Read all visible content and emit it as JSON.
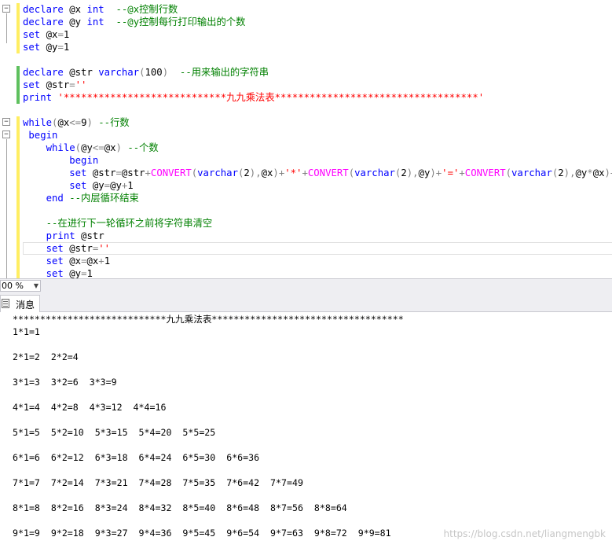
{
  "editor": {
    "lines": [
      [
        {
          "t": "declare",
          "c": "k"
        },
        {
          "t": " @x "
        },
        {
          "t": "int",
          "c": "k"
        },
        {
          "t": "  "
        },
        {
          "t": "--@x控制行数",
          "c": "c"
        }
      ],
      [
        {
          "t": "declare",
          "c": "k"
        },
        {
          "t": " @y "
        },
        {
          "t": "int",
          "c": "k"
        },
        {
          "t": "  "
        },
        {
          "t": "--@y控制每行打印输出的个数",
          "c": "c"
        }
      ],
      [
        {
          "t": "set",
          "c": "k"
        },
        {
          "t": " @x"
        },
        {
          "t": "=",
          "c": "g"
        },
        {
          "t": "1"
        }
      ],
      [
        {
          "t": "set",
          "c": "k"
        },
        {
          "t": " @y"
        },
        {
          "t": "=",
          "c": "g"
        },
        {
          "t": "1"
        }
      ],
      [],
      [
        {
          "t": "declare",
          "c": "k"
        },
        {
          "t": " @str "
        },
        {
          "t": "varchar",
          "c": "k"
        },
        {
          "t": "(",
          "c": "g"
        },
        {
          "t": "100"
        },
        {
          "t": ")",
          "c": "g"
        },
        {
          "t": "  "
        },
        {
          "t": "--用来输出的字符串",
          "c": "c"
        }
      ],
      [
        {
          "t": "set",
          "c": "k"
        },
        {
          "t": " @str"
        },
        {
          "t": "=",
          "c": "g"
        },
        {
          "t": "''",
          "c": "s"
        }
      ],
      [
        {
          "t": "print",
          "c": "k"
        },
        {
          "t": " "
        },
        {
          "t": "'****************************九九乘法表***********************************'",
          "c": "s"
        }
      ],
      [],
      [
        {
          "t": "while",
          "c": "k"
        },
        {
          "t": "(",
          "c": "g"
        },
        {
          "t": "@x"
        },
        {
          "t": "<=",
          "c": "g"
        },
        {
          "t": "9"
        },
        {
          "t": ")",
          "c": "g"
        },
        {
          "t": " "
        },
        {
          "t": "--行数",
          "c": "c"
        }
      ],
      [
        {
          "t": " "
        },
        {
          "t": "begin",
          "c": "k"
        }
      ],
      [
        {
          "t": "    "
        },
        {
          "t": "while",
          "c": "k"
        },
        {
          "t": "(",
          "c": "g"
        },
        {
          "t": "@y"
        },
        {
          "t": "<=",
          "c": "g"
        },
        {
          "t": "@x"
        },
        {
          "t": ")",
          "c": "g"
        },
        {
          "t": " "
        },
        {
          "t": "--个数",
          "c": "c"
        }
      ],
      [
        {
          "t": "        "
        },
        {
          "t": "begin",
          "c": "k"
        }
      ],
      [
        {
          "t": "        "
        },
        {
          "t": "set",
          "c": "k"
        },
        {
          "t": " @str"
        },
        {
          "t": "=",
          "c": "g"
        },
        {
          "t": "@str"
        },
        {
          "t": "+",
          "c": "g"
        },
        {
          "t": "CONVERT",
          "c": "f"
        },
        {
          "t": "(",
          "c": "g"
        },
        {
          "t": "varchar",
          "c": "k"
        },
        {
          "t": "(",
          "c": "g"
        },
        {
          "t": "2"
        },
        {
          "t": "),",
          "c": "g"
        },
        {
          "t": "@x"
        },
        {
          "t": ")+",
          "c": "g"
        },
        {
          "t": "'*'",
          "c": "s"
        },
        {
          "t": "+",
          "c": "g"
        },
        {
          "t": "CONVERT",
          "c": "f"
        },
        {
          "t": "(",
          "c": "g"
        },
        {
          "t": "varchar",
          "c": "k"
        },
        {
          "t": "(",
          "c": "g"
        },
        {
          "t": "2"
        },
        {
          "t": "),",
          "c": "g"
        },
        {
          "t": "@y"
        },
        {
          "t": ")+",
          "c": "g"
        },
        {
          "t": "'='",
          "c": "s"
        },
        {
          "t": "+",
          "c": "g"
        },
        {
          "t": "CONVERT",
          "c": "f"
        },
        {
          "t": "(",
          "c": "g"
        },
        {
          "t": "varchar",
          "c": "k"
        },
        {
          "t": "(",
          "c": "g"
        },
        {
          "t": "2"
        },
        {
          "t": "),",
          "c": "g"
        },
        {
          "t": "@y"
        },
        {
          "t": "*",
          "c": "g"
        },
        {
          "t": "@x"
        },
        {
          "t": ")+",
          "c": "g"
        },
        {
          "t": "'  '",
          "c": "s"
        }
      ],
      [
        {
          "t": "        "
        },
        {
          "t": "set",
          "c": "k"
        },
        {
          "t": " @y"
        },
        {
          "t": "=",
          "c": "g"
        },
        {
          "t": "@y"
        },
        {
          "t": "+",
          "c": "g"
        },
        {
          "t": "1"
        }
      ],
      [
        {
          "t": "    "
        },
        {
          "t": "end",
          "c": "k"
        },
        {
          "t": " "
        },
        {
          "t": "--内层循环结束",
          "c": "c"
        }
      ],
      [],
      [
        {
          "t": "    "
        },
        {
          "t": "--在进行下一轮循环之前将字符串清空",
          "c": "c"
        }
      ],
      [
        {
          "t": "    "
        },
        {
          "t": "print",
          "c": "k"
        },
        {
          "t": " @str"
        }
      ],
      [
        {
          "t": "    "
        },
        {
          "t": "set",
          "c": "k"
        },
        {
          "t": " @str"
        },
        {
          "t": "=",
          "c": "g"
        },
        {
          "t": "''",
          "c": "s"
        }
      ],
      [
        {
          "t": "    "
        },
        {
          "t": "set",
          "c": "k"
        },
        {
          "t": " @x"
        },
        {
          "t": "=",
          "c": "g"
        },
        {
          "t": "@x"
        },
        {
          "t": "+",
          "c": "g"
        },
        {
          "t": "1"
        }
      ],
      [
        {
          "t": "    "
        },
        {
          "t": "set",
          "c": "k"
        },
        {
          "t": " @y"
        },
        {
          "t": "=",
          "c": "g"
        },
        {
          "t": "1"
        }
      ]
    ]
  },
  "zoom": {
    "value": "00 %"
  },
  "results": {
    "tab_label": "消息",
    "messages": [
      "****************************九九乘法表***********************************",
      "1*1=1",
      "2*1=2  2*2=4",
      "3*1=3  3*2=6  3*3=9",
      "4*1=4  4*2=8  4*3=12  4*4=16",
      "5*1=5  5*2=10  5*3=15  5*4=20  5*5=25",
      "6*1=6  6*2=12  6*3=18  6*4=24  6*5=30  6*6=36",
      "7*1=7  7*2=14  7*3=21  7*4=28  7*5=35  7*6=42  7*7=49",
      "8*1=8  8*2=16  8*3=24  8*4=32  8*5=40  8*6=48  8*7=56  8*8=64",
      "9*1=9  9*2=18  9*3=27  9*4=36  9*5=45  9*6=54  9*7=63  9*8=72  9*9=81"
    ]
  },
  "watermark": "https://blog.csdn.net/liangmengbk"
}
